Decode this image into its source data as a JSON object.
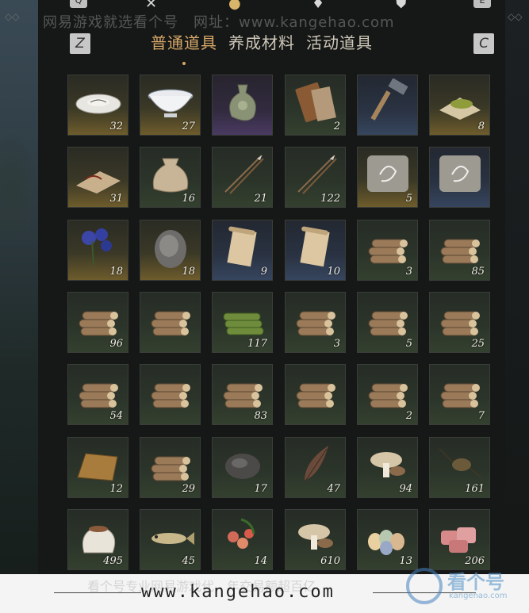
{
  "watermark_top": "网易游戏就选看个号　网址：www.kangehao.com",
  "top_keys": {
    "left_top": "Q",
    "right_top": "E",
    "left": "Z",
    "right": "C"
  },
  "tabs": [
    {
      "label": "普通道具",
      "active": true
    },
    {
      "label": "养成材料",
      "active": false
    },
    {
      "label": "活动道具",
      "active": false
    }
  ],
  "items": [
    {
      "icon": "plate-icon",
      "count": "32",
      "rarity": "gold"
    },
    {
      "icon": "bowl-icon",
      "count": "27",
      "rarity": "gold"
    },
    {
      "icon": "vase-icon",
      "count": "",
      "rarity": "purple"
    },
    {
      "icon": "wooden-tablet-icon",
      "count": "2",
      "rarity": "green"
    },
    {
      "icon": "hammer-icon",
      "count": "",
      "rarity": "blue"
    },
    {
      "icon": "powder-icon",
      "count": "8",
      "rarity": "gold"
    },
    {
      "icon": "scroll-mat-icon",
      "count": "31",
      "rarity": "gold"
    },
    {
      "icon": "cloth-bag-icon",
      "count": "16",
      "rarity": "green"
    },
    {
      "icon": "arrow-icon",
      "count": "21",
      "rarity": "green"
    },
    {
      "icon": "arrow-icon",
      "count": "122",
      "rarity": "green"
    },
    {
      "icon": "stone-rubbing-icon",
      "count": "5",
      "rarity": "gold"
    },
    {
      "icon": "stone-rubbing-icon",
      "count": "",
      "rarity": "blue"
    },
    {
      "icon": "blue-flower-icon",
      "count": "18",
      "rarity": "gold"
    },
    {
      "icon": "ore-icon",
      "count": "18",
      "rarity": "gold"
    },
    {
      "icon": "scroll-icon",
      "count": "9",
      "rarity": "blue"
    },
    {
      "icon": "scroll-icon",
      "count": "10",
      "rarity": "blue"
    },
    {
      "icon": "log-icon",
      "count": "3",
      "rarity": "green"
    },
    {
      "icon": "log-icon",
      "count": "85",
      "rarity": "green"
    },
    {
      "icon": "log-icon",
      "count": "96",
      "rarity": "green"
    },
    {
      "icon": "log-icon",
      "count": "",
      "rarity": "green"
    },
    {
      "icon": "bamboo-icon",
      "count": "117",
      "rarity": "green"
    },
    {
      "icon": "log-icon",
      "count": "3",
      "rarity": "green"
    },
    {
      "icon": "log-icon",
      "count": "5",
      "rarity": "green"
    },
    {
      "icon": "log-icon",
      "count": "25",
      "rarity": "green"
    },
    {
      "icon": "log-icon",
      "count": "54",
      "rarity": "green"
    },
    {
      "icon": "log-icon",
      "count": "",
      "rarity": "green"
    },
    {
      "icon": "log-icon",
      "count": "83",
      "rarity": "green"
    },
    {
      "icon": "log-icon",
      "count": "",
      "rarity": "green"
    },
    {
      "icon": "log-icon",
      "count": "2",
      "rarity": "green"
    },
    {
      "icon": "log-icon",
      "count": "7",
      "rarity": "green"
    },
    {
      "icon": "straw-icon",
      "count": "12",
      "rarity": "green"
    },
    {
      "icon": "log-icon",
      "count": "29",
      "rarity": "green"
    },
    {
      "icon": "rock-icon",
      "count": "17",
      "rarity": "green"
    },
    {
      "icon": "feather-icon",
      "count": "47",
      "rarity": "green"
    },
    {
      "icon": "mushroom-icon",
      "count": "94",
      "rarity": "green"
    },
    {
      "icon": "cricket-icon",
      "count": "161",
      "rarity": "green"
    },
    {
      "icon": "grain-sack-icon",
      "count": "495",
      "rarity": "green"
    },
    {
      "icon": "fish-icon",
      "count": "45",
      "rarity": "green"
    },
    {
      "icon": "berries-icon",
      "count": "14",
      "rarity": "green"
    },
    {
      "icon": "mushroom-icon",
      "count": "610",
      "rarity": "green"
    },
    {
      "icon": "eggs-icon",
      "count": "13",
      "rarity": "green"
    },
    {
      "icon": "meat-icon",
      "count": "206",
      "rarity": "green"
    }
  ],
  "bottom": {
    "slogan": "看个号专业网易游戏代　年交易额超百亿",
    "site": "www.kangehao.com",
    "logo_name": "看个号",
    "logo_domain": "kangehao.com"
  }
}
